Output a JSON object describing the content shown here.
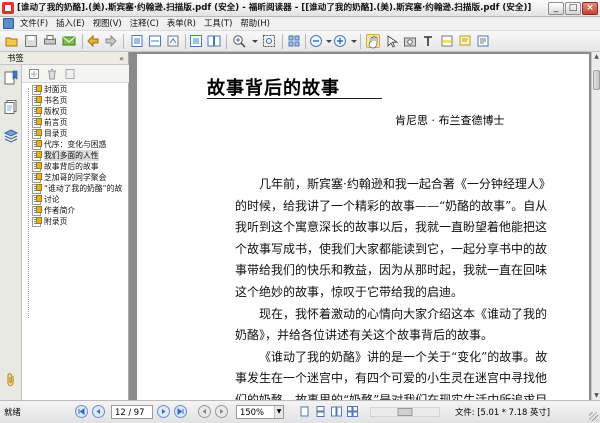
{
  "window": {
    "title": "[谁动了我的奶酪].(美).斯宾塞·约翰逊.扫描版.pdf (安全) - 福昕阅读器 - [[谁动了我的奶酪].(美).斯宾塞·约翰逊.扫描版.pdf (安全)]",
    "minimize": "_",
    "maximize": "□",
    "close": "×"
  },
  "menu": {
    "items": [
      "文件(F)",
      "插入(E)",
      "视图(V)",
      "注释(C)",
      "表单(R)",
      "工具(T)",
      "帮助(H)"
    ]
  },
  "toolbar": {
    "icons": [
      "open-file-icon",
      "save-icon",
      "print-icon",
      "email-icon",
      "back-icon",
      "forward-icon",
      "fit-page-icon",
      "fit-width-icon",
      "zoom-in-icon",
      "zoom-dropdown-icon",
      "zoom-out-icon",
      "zoom-in-circle-icon",
      "hand-tool-icon",
      "select-text-icon",
      "snapshot-icon",
      "typewriter-icon",
      "highlight-icon",
      "note-icon",
      "properties-icon",
      "rotate-icon"
    ]
  },
  "bookmarks_panel": {
    "title": "书签",
    "collapse": "«",
    "items": [
      {
        "label": "封面页"
      },
      {
        "label": "书名页"
      },
      {
        "label": "版权页"
      },
      {
        "label": "前言页"
      },
      {
        "label": "目录页"
      },
      {
        "label": "代序：变化与困惑"
      },
      {
        "label": "我们多面的人性"
      },
      {
        "label": "故事背后的故事"
      },
      {
        "label": "芝加哥的同学聚会"
      },
      {
        "label": "“谁动了我的奶酪”的故"
      },
      {
        "label": "讨论"
      },
      {
        "label": "作者简介"
      },
      {
        "label": "附录页"
      }
    ],
    "selected_index": 6
  },
  "document": {
    "chapter_title": "故事背后的故事",
    "author": "肯尼思 · 布兰查德博士",
    "paragraphs": [
      "几年前，斯宾塞·约翰逊和我一起合著《一分钟经理人》的时候，给我讲了一个精彩的故事——“奶酪的故事”。自从我听到这个寓意深长的故事以后，我就一直盼望着他能把这个故事写成书，使我们大家都能读到它，一起分享书中的故事带给我们的快乐和教益，因为从那时起，我就一直在回味这个绝妙的故事，惊叹于它带给我的启迪。",
      "现在，我怀着激动的心情向大家介绍这本《谁动了我的奶酪》，并给各位讲述有关这个故事背后的故事。",
      "《谁动了我的奶酪》讲的是一个关于“变化”的故事。故事发生在一个迷宫中，有四个可爱的小生灵在迷宫中寻找他们的奶酪。故事里的“奶酪”是对我们在现实生活中所追求目标的一种"
    ]
  },
  "statusbar": {
    "status": "就绪",
    "page_value": "12 / 97",
    "zoom_value": "150%",
    "file_info": "文件: [5.01 * 7.18 英寸]"
  },
  "colors": {
    "accent": "#2f6ec1",
    "doc_background": "#8b8b8b",
    "close_button": "#c6402f"
  }
}
